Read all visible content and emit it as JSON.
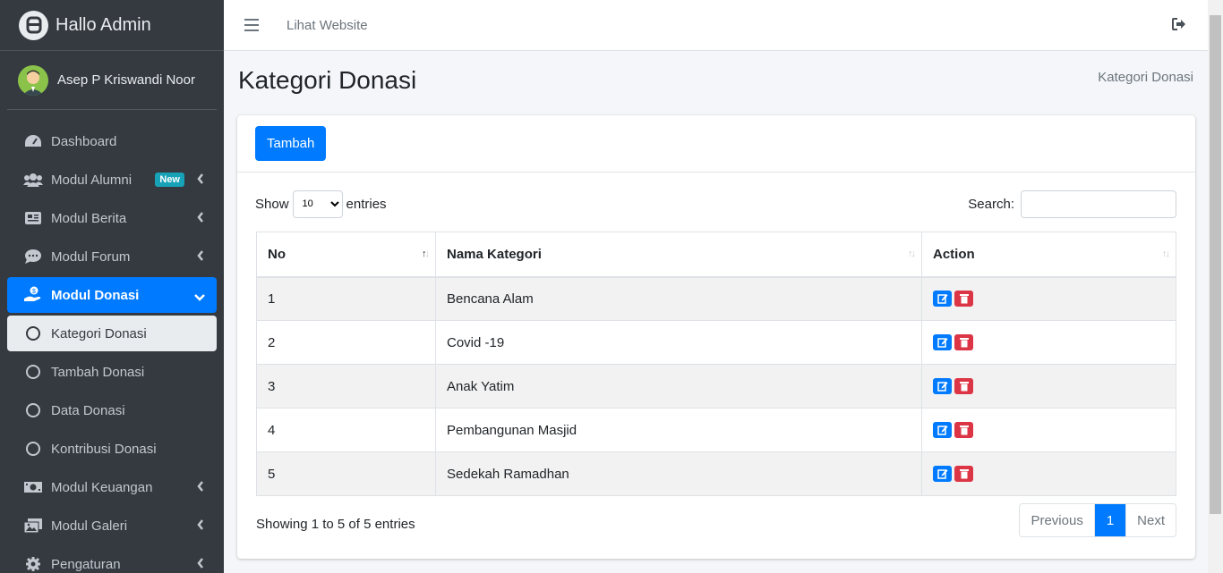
{
  "brand": {
    "title": "Hallo Admin"
  },
  "user": {
    "name": "Asep P Kriswandi Noor"
  },
  "sidebar": {
    "items": [
      {
        "label": "Dashboard"
      },
      {
        "label": "Modul Alumni",
        "badge": "New"
      },
      {
        "label": "Modul Berita"
      },
      {
        "label": "Modul Forum"
      },
      {
        "label": "Modul Donasi"
      },
      {
        "label": "Kategori Donasi"
      },
      {
        "label": "Tambah Donasi"
      },
      {
        "label": "Data Donasi"
      },
      {
        "label": "Kontribusi Donasi"
      },
      {
        "label": "Modul Keuangan"
      },
      {
        "label": "Modul Galeri"
      },
      {
        "label": "Pengaturan"
      }
    ]
  },
  "topbar": {
    "link": "Lihat Website"
  },
  "page": {
    "title": "Kategori Donasi",
    "breadcrumb": "Kategori Donasi"
  },
  "card": {
    "add_label": "Tambah"
  },
  "table_controls": {
    "show_label": "Show",
    "entries_label": "entries",
    "page_length": "10",
    "search_label": "Search:"
  },
  "table": {
    "headers": [
      "No",
      "Nama Kategori",
      "Action"
    ],
    "rows": [
      {
        "no": "1",
        "name": "Bencana Alam"
      },
      {
        "no": "2",
        "name": "Covid -19"
      },
      {
        "no": "3",
        "name": "Anak Yatim"
      },
      {
        "no": "4",
        "name": "Pembangunan Masjid"
      },
      {
        "no": "5",
        "name": "Sedekah Ramadhan"
      }
    ]
  },
  "footer": {
    "info": "Showing 1 to 5 of 5 entries",
    "previous": "Previous",
    "current_page": "1",
    "next": "Next"
  },
  "colors": {
    "sidebar_bg": "#343a40",
    "primary": "#007bff",
    "danger": "#dc3545",
    "badge": "#17a2b8"
  }
}
